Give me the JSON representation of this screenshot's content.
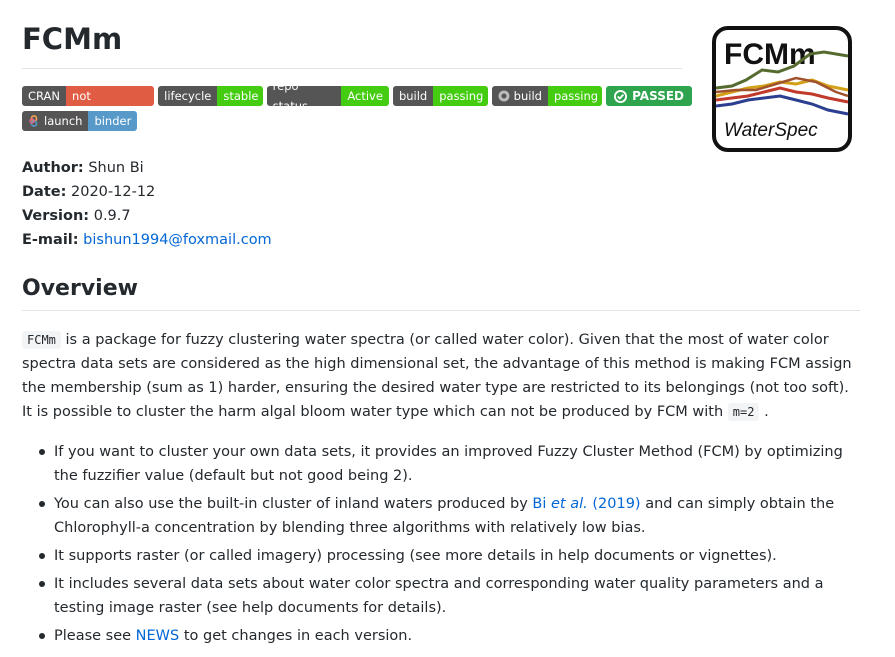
{
  "title": "FCMm",
  "logo": {
    "text_top": "FCMm",
    "text_bottom": "WaterSpec"
  },
  "badges": {
    "row1": [
      {
        "label": "CRAN",
        "value": "not published",
        "color": "red"
      },
      {
        "label": "lifecycle",
        "value": "stable",
        "color": "green"
      },
      {
        "label": "repo status",
        "value": "Active",
        "color": "green"
      },
      {
        "label": "build",
        "value": "passing",
        "color": "green"
      },
      {
        "label": "build",
        "value": "passing",
        "color": "green",
        "icon": "appveyor-icon"
      }
    ],
    "passed": "PASSED",
    "row2": [
      {
        "label": "launch",
        "value": "binder",
        "color": "blue",
        "icon": "binder-icon"
      }
    ]
  },
  "meta": {
    "author_label": "Author:",
    "author": "Shun Bi",
    "date_label": "Date:",
    "date": "2020-12-12",
    "version_label": "Version:",
    "version": "0.9.7",
    "email_label": "E-mail:",
    "email": "bishun1994@foxmail.com"
  },
  "overview": {
    "heading": "Overview",
    "code1": "FCMm",
    "text1": " is a package for fuzzy clustering water spectra (or called water color). Given that the most of water color spectra data sets are considered as the high dimensional set, the advantage of this method is making FCM assign the membership (sum as 1) harder, ensuring the desired water type are restricted to its belongings (not too soft). It is possible to cluster the harm algal bloom water type which can not be produced by FCM with ",
    "code2": "m=2",
    "text2": " ."
  },
  "bullets": {
    "b1": "If you want to cluster your own data sets, it provides an improved Fuzzy Cluster Method (FCM) by optimizing the fuzzifier value (default but not good being 2).",
    "b2_pre": "You can also use the built-in cluster of inland waters produced by ",
    "b2_link_a": "Bi ",
    "b2_link_b": "et al.",
    "b2_link_c": " (2019)",
    "b2_post": " and can simply obtain the Chlorophyll-a concentration by blending three algorithms with relatively low bias.",
    "b3": "It supports raster (or called imagery) processing (see more details in help documents or vignettes).",
    "b4": "It includes several data sets about water color spectra and corresponding water quality parameters and a testing image raster (see help documents for details).",
    "b5_pre": "Please see ",
    "b5_link": "NEWS",
    "b5_post": " to get changes in each version."
  }
}
